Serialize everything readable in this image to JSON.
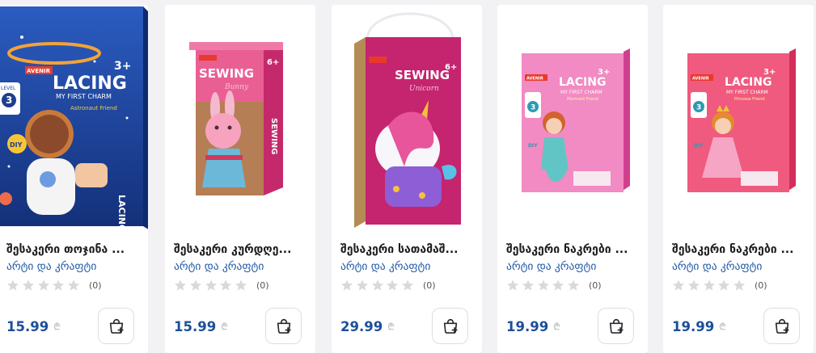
{
  "products": [
    {
      "title": "შესაკერი თოჯინა ...",
      "brand": "არტი და კრაფტი",
      "rating_count": "(0)",
      "price": "15.99",
      "currency": "₾",
      "icon": "add-to-cart-icon"
    },
    {
      "title": "შესაკერი კურდღე...",
      "brand": "არტი და კრაფტი",
      "rating_count": "(0)",
      "price": "15.99",
      "currency": "₾",
      "icon": "add-to-cart-icon"
    },
    {
      "title": "შესაკერი სათამაშ...",
      "brand": "არტი და კრაფტი",
      "rating_count": "(0)",
      "price": "29.99",
      "currency": "₾",
      "icon": "add-to-cart-icon"
    },
    {
      "title": "შესაკერი ნაკრები ...",
      "brand": "არტი და კრაფტი",
      "rating_count": "(0)",
      "price": "19.99",
      "currency": "₾",
      "icon": "add-to-cart-icon"
    },
    {
      "title": "შესაკერი ნაკრები ...",
      "brand": "არტი და კრაფტი",
      "rating_count": "(0)",
      "price": "19.99",
      "currency": "₾",
      "icon": "add-to-cart-icon"
    }
  ],
  "box_art": {
    "lacing": "LACING",
    "my_first_charm": "MY FIRST CHARM",
    "astronaut_friend": "Astronaut Friend",
    "mermaid_friend": "Mermaid Friend",
    "princess_friend": "Princess Friend",
    "level": "LEVEL",
    "level_num": "3",
    "diy": "DIY",
    "age": "3+",
    "age6": "6+",
    "sewing": "SEWING",
    "bunny": "Bunny",
    "unicorn": "Unicorn",
    "brand_logo": "AVENIR"
  },
  "colors": {
    "price": "#1c4f99",
    "brand": "#1f59a8",
    "star": "#d9d9dc"
  }
}
